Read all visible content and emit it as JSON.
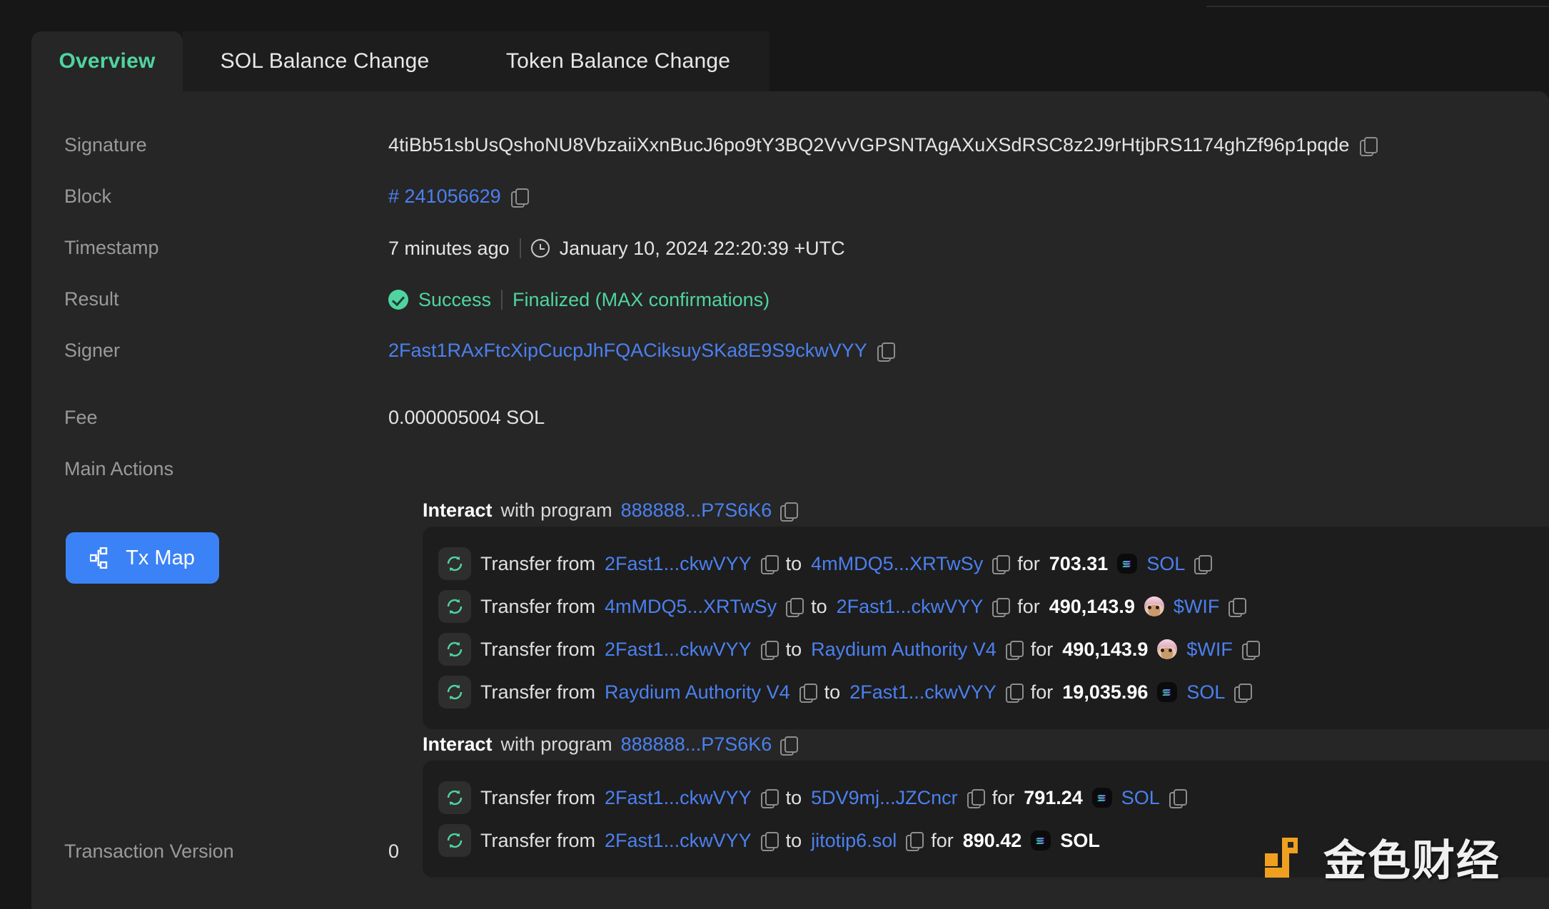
{
  "tabs": [
    {
      "label": "Overview",
      "active": true
    },
    {
      "label": "SOL Balance Change",
      "active": false
    },
    {
      "label": "Token Balance Change",
      "active": false
    }
  ],
  "details": {
    "signature": {
      "label": "Signature",
      "value": "4tiBb51sbUsQshoNU8VbzaiiXxnBucJ6po9tY3BQ2VvVGPSNTAgAXuXSdRSC8z2J9rHtjbRS1174ghZf96p1pqde"
    },
    "block": {
      "label": "Block",
      "value": "# 241056629"
    },
    "timestamp": {
      "label": "Timestamp",
      "relative": "7 minutes ago",
      "absolute": "January 10, 2024 22:20:39 +UTC"
    },
    "result": {
      "label": "Result",
      "status": "Success",
      "confirmation": "Finalized (MAX confirmations)"
    },
    "signer": {
      "label": "Signer",
      "value": "2Fast1RAxFtcXipCucpJhFQACiksuySKa8E9S9ckwVYY"
    },
    "fee": {
      "label": "Fee",
      "value": "0.000005004 SOL"
    },
    "main_actions": {
      "label": "Main Actions",
      "tx_map_button": "Tx Map"
    },
    "transaction_version": {
      "label": "Transaction Version",
      "value": "0"
    }
  },
  "interactions": [
    {
      "prefix": "Interact",
      "middle": "with program",
      "program": "888888...P7S6K6",
      "transfers": [
        {
          "verb": "Transfer from",
          "from": "2Fast1...ckwVYY",
          "to_label": "to",
          "to": "4mMDQ5...XRTwSy",
          "for_label": "for",
          "amount": "703.31",
          "token": "SOL",
          "token_icon": "sol-token-icon",
          "has_trailing_copy": true,
          "highlight": false
        },
        {
          "verb": "Transfer from",
          "from": "4mMDQ5...XRTwSy",
          "to_label": "to",
          "to": "2Fast1...ckwVYY",
          "for_label": "for",
          "amount": "490,143.9",
          "token": "$WIF",
          "token_icon": "wif-token-icon",
          "has_trailing_copy": true,
          "highlight": false
        },
        {
          "verb": "Transfer from",
          "from": "2Fast1...ckwVYY",
          "to_label": "to",
          "to": "Raydium Authority V4",
          "for_label": "for",
          "amount": "490,143.9",
          "token": "$WIF",
          "token_icon": "wif-token-icon",
          "has_trailing_copy": true,
          "highlight": false
        },
        {
          "verb": "Transfer from",
          "from": "Raydium Authority V4",
          "to_label": "to",
          "to": "2Fast1...ckwVYY",
          "for_label": "for",
          "amount": "19,035.96",
          "token": "SOL",
          "token_icon": "sol-token-icon",
          "has_trailing_copy": true,
          "highlight": false
        }
      ]
    },
    {
      "prefix": "Interact",
      "middle": "with program",
      "program": "888888...P7S6K6",
      "transfers": [
        {
          "verb": "Transfer from",
          "from": "2Fast1...ckwVYY",
          "to_label": "to",
          "to": "5DV9mj...JZCncr",
          "for_label": "for",
          "amount": "791.24",
          "token": "SOL",
          "token_icon": "sol-token-icon",
          "has_trailing_copy": true,
          "highlight": false
        },
        {
          "verb": "Transfer from",
          "from": "2Fast1...ckwVYY",
          "to_label": "to",
          "to": "jitotip6.sol",
          "for_label": "for",
          "amount": "890.42",
          "token": "SOL",
          "token_icon": "sol-token-icon",
          "has_trailing_copy": false,
          "highlight": true
        }
      ]
    }
  ],
  "watermark": {
    "text": "金色财经"
  },
  "colors": {
    "accent_green": "#4fd4a0",
    "link_blue": "#4b80f0",
    "button_blue": "#3b82f6",
    "panel_bg": "#262626",
    "page_bg": "#171717",
    "transfer_bg": "#1d1d1d",
    "watermark_orange": "#f0a020"
  }
}
